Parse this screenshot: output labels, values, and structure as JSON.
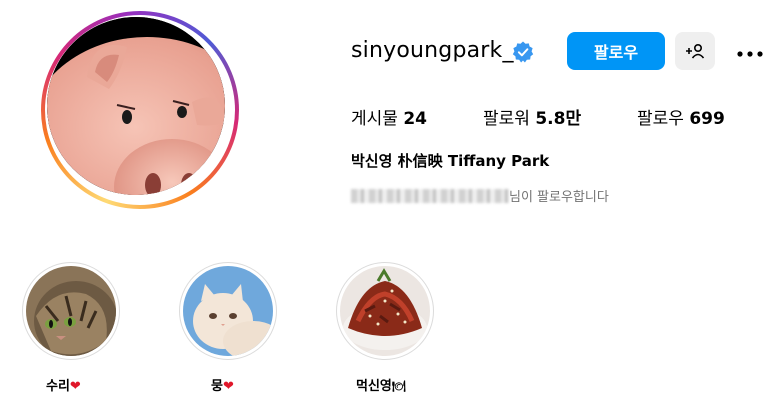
{
  "profile": {
    "username": "sinyoungpark_",
    "verified": true,
    "full_name": "박신영 朴信映 Tiffany Park",
    "followed_by_suffix": "님이 팔로우합니다"
  },
  "actions": {
    "follow_label": "팔로우",
    "suggest_label": "+ጰ",
    "more_label": "•••"
  },
  "stats": {
    "posts_label": "게시물",
    "posts_value": "24",
    "followers_label": "팔로워",
    "followers_value": "5.8만",
    "following_label": "팔로우",
    "following_value": "699"
  },
  "highlights": [
    {
      "label": "수리",
      "emoji": "❤"
    },
    {
      "label": "뭉",
      "emoji": "❤"
    },
    {
      "label": "먹신영",
      "emoji": "🍽"
    }
  ],
  "colors": {
    "accent": "#0095f6",
    "verified": "#3897f0",
    "heart": "#e0172a"
  }
}
